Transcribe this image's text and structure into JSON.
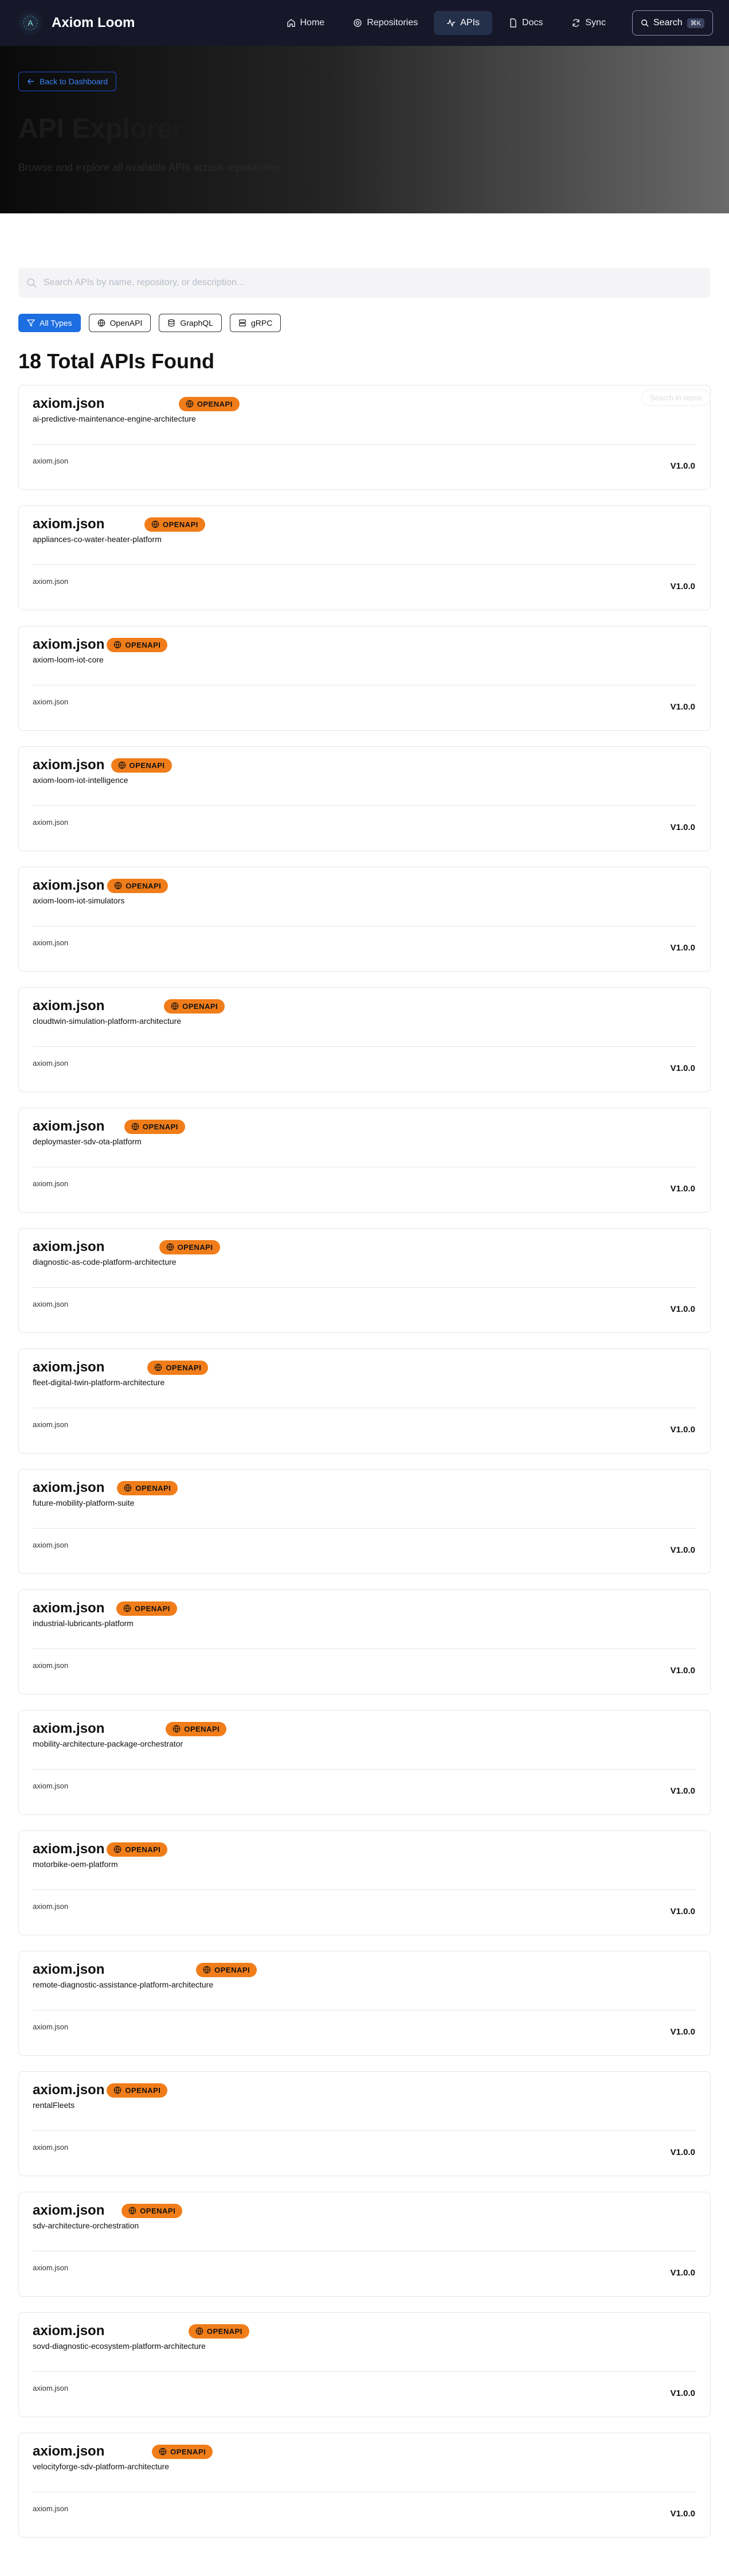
{
  "app": {
    "name": "Axiom Loom",
    "logo_letter": "A"
  },
  "nav": {
    "items": [
      {
        "label": "Home",
        "icon": "home-icon"
      },
      {
        "label": "Repositories",
        "icon": "repo-icon"
      },
      {
        "label": "APIs",
        "icon": "activity-icon",
        "active": true
      },
      {
        "label": "Docs",
        "icon": "document-icon"
      },
      {
        "label": "Sync",
        "icon": "sync-icon"
      }
    ],
    "search_label": "Search",
    "search_shortcut": "⌘K"
  },
  "hero": {
    "back_label": "Back to Dashboard",
    "title": "API Explorer",
    "subtitle": "Browse and explore all available APIs across repositories"
  },
  "search": {
    "placeholder": "Search APIs by name, repository, or description..."
  },
  "filters": [
    {
      "label": "All Types",
      "icon": "filter-icon",
      "active": true
    },
    {
      "label": "OpenAPI",
      "icon": "globe-icon"
    },
    {
      "label": "GraphQL",
      "icon": "database-icon"
    },
    {
      "label": "gRPC",
      "icon": "server-icon"
    }
  ],
  "results_title": "18 Total APIs Found",
  "ghost_button": "Search in repos",
  "apis": [
    {
      "title": "axiom.json",
      "repo": "ai-predictive-maintenance-engine-architecture",
      "type": "OPENAPI",
      "file": "axiom.json",
      "version": "V1.0.0"
    },
    {
      "title": "axiom.json",
      "repo": "appliances-co-water-heater-platform",
      "type": "OPENAPI",
      "file": "axiom.json",
      "version": "V1.0.0"
    },
    {
      "title": "axiom.json",
      "repo": "axiom-loom-iot-core",
      "type": "OPENAPI",
      "file": "axiom.json",
      "version": "V1.0.0"
    },
    {
      "title": "axiom.json",
      "repo": "axiom-loom-iot-intelligence",
      "type": "OPENAPI",
      "file": "axiom.json",
      "version": "V1.0.0"
    },
    {
      "title": "axiom.json",
      "repo": "axiom-loom-iot-simulators",
      "type": "OPENAPI",
      "file": "axiom.json",
      "version": "V1.0.0"
    },
    {
      "title": "axiom.json",
      "repo": "cloudtwin-simulation-platform-architecture",
      "type": "OPENAPI",
      "file": "axiom.json",
      "version": "V1.0.0"
    },
    {
      "title": "axiom.json",
      "repo": "deploymaster-sdv-ota-platform",
      "type": "OPENAPI",
      "file": "axiom.json",
      "version": "V1.0.0"
    },
    {
      "title": "axiom.json",
      "repo": "diagnostic-as-code-platform-architecture",
      "type": "OPENAPI",
      "file": "axiom.json",
      "version": "V1.0.0"
    },
    {
      "title": "axiom.json",
      "repo": "fleet-digital-twin-platform-architecture",
      "type": "OPENAPI",
      "file": "axiom.json",
      "version": "V1.0.0"
    },
    {
      "title": "axiom.json",
      "repo": "future-mobility-platform-suite",
      "type": "OPENAPI",
      "file": "axiom.json",
      "version": "V1.0.0"
    },
    {
      "title": "axiom.json",
      "repo": "industrial-lubricants-platform",
      "type": "OPENAPI",
      "file": "axiom.json",
      "version": "V1.0.0"
    },
    {
      "title": "axiom.json",
      "repo": "mobility-architecture-package-orchestrator",
      "type": "OPENAPI",
      "file": "axiom.json",
      "version": "V1.0.0"
    },
    {
      "title": "axiom.json",
      "repo": "motorbike-oem-platform",
      "type": "OPENAPI",
      "file": "axiom.json",
      "version": "V1.0.0"
    },
    {
      "title": "axiom.json",
      "repo": "remote-diagnostic-assistance-platform-architecture",
      "type": "OPENAPI",
      "file": "axiom.json",
      "version": "V1.0.0"
    },
    {
      "title": "axiom.json",
      "repo": "rentalFleets",
      "type": "OPENAPI",
      "file": "axiom.json",
      "version": "V1.0.0"
    },
    {
      "title": "axiom.json",
      "repo": "sdv-architecture-orchestration",
      "type": "OPENAPI",
      "file": "axiom.json",
      "version": "V1.0.0"
    },
    {
      "title": "axiom.json",
      "repo": "sovd-diagnostic-ecosystem-platform-architecture",
      "type": "OPENAPI",
      "file": "axiom.json",
      "version": "V1.0.0"
    },
    {
      "title": "axiom.json",
      "repo": "velocityforge-sdv-platform-architecture",
      "type": "OPENAPI",
      "file": "axiom.json",
      "version": "V1.0.0"
    }
  ],
  "colors": {
    "accent": "#1d6ee0",
    "badge": "#f07d1a",
    "nav_bg": "#17172a"
  }
}
